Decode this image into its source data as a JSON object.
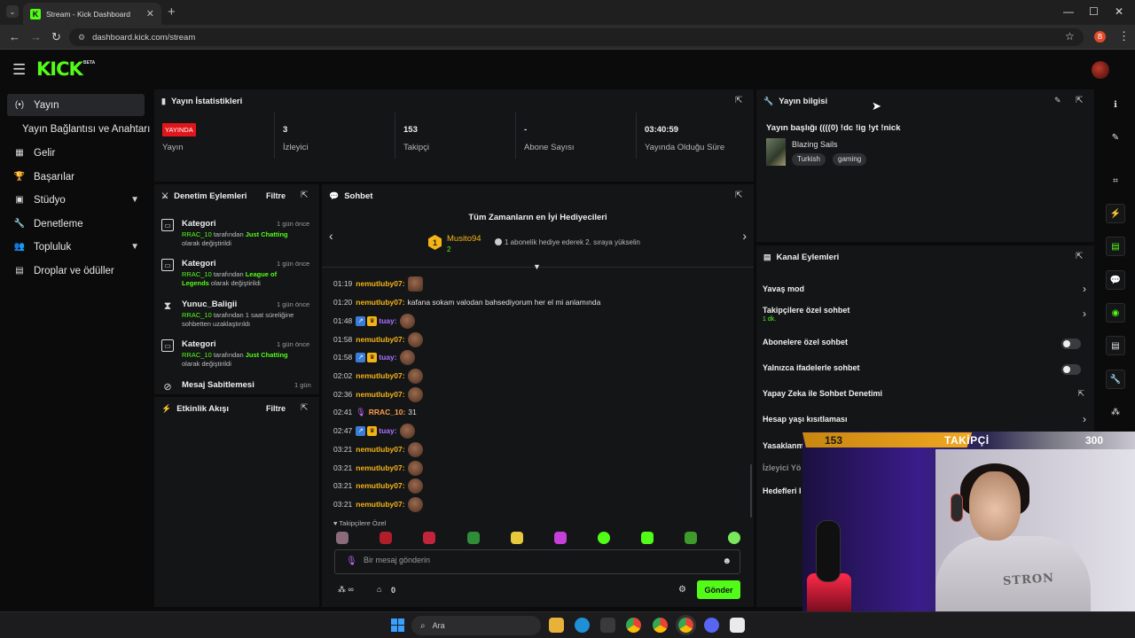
{
  "browser": {
    "tab_title": "Stream - Kick Dashboard",
    "url": "dashboard.kick.com/stream",
    "profile_initial": "B"
  },
  "header": {
    "logo": "KICK",
    "logo_badge": "BETA"
  },
  "sidebar": {
    "items": [
      {
        "label": "Yayın",
        "icon": "broadcast-icon"
      },
      {
        "label": "Yayın Bağlantısı ve Anahtarı",
        "icon": ""
      },
      {
        "label": "Gelir",
        "icon": "revenue-icon"
      },
      {
        "label": "Başarılar",
        "icon": "trophy-icon"
      },
      {
        "label": "Stüdyo",
        "icon": "studio-icon"
      },
      {
        "label": "Denetleme",
        "icon": "wrench-icon"
      },
      {
        "label": "Topluluk",
        "icon": "community-icon"
      },
      {
        "label": "Droplar ve ödüller",
        "icon": "gift-icon"
      }
    ]
  },
  "stats": {
    "title": "Yayın İstatistikleri",
    "live_badge": "YAYINDA",
    "live_label": "Yayın",
    "viewers": "3",
    "viewers_label": "İzleyici",
    "followers": "153",
    "followers_label": "Takipçi",
    "subs": "-",
    "subs_label": "Abone Sayısı",
    "uptime": "03:40:59",
    "uptime_label": "Yayında Olduğu Süre"
  },
  "moderation": {
    "title": "Denetim Eylemleri",
    "filter": "Filtre",
    "items": [
      {
        "title": "Kategori",
        "time": "1 gün önce",
        "user": "RRAC_10",
        "mid": " tarafından ",
        "target": "Just Chatting",
        "end": " olarak değiştirildi"
      },
      {
        "title": "Kategori",
        "time": "1 gün önce",
        "user": "RRAC_10",
        "mid": " tarafından ",
        "target": "League of Legends",
        "end": " olarak değiştirildi"
      },
      {
        "title": "Yunuc_Baligii",
        "time": "1 gün önce",
        "user": "RRAC_10",
        "mid": " tarafından 1 saat süreliğine sohbetten uzaklaştırıldı",
        "target": "",
        "end": ""
      },
      {
        "title": "Kategori",
        "time": "1 gün önce",
        "user": "RRAC_10",
        "mid": " tarafından ",
        "target": "Just Chatting",
        "end": " olarak değiştirildi"
      },
      {
        "title": "Mesaj Sabitlemesi",
        "time": "1 gün"
      }
    ]
  },
  "activity": {
    "title": "Etkinlik Akışı",
    "filter": "Filtre"
  },
  "chat": {
    "title": "Sohbet",
    "gifters_title": "Tüm Zamanların en İyi Hediyecileri",
    "top_gifter": {
      "rank": "1",
      "name": "Musito94",
      "count": "2"
    },
    "gifter_msg": "1 abonelik hediye ederek 2. sıraya yükselin",
    "messages": [
      {
        "time": "01:19",
        "user": "nemutluby07:",
        "text": "",
        "kind": "gold"
      },
      {
        "time": "01:20",
        "user": "nemutluby07:",
        "text": "kafana sokam valodan bahsediyorum her el mi anlamında",
        "kind": "gold"
      },
      {
        "time": "01:48",
        "user": "tuay:",
        "text": "",
        "kind": "purple"
      },
      {
        "time": "01:58",
        "user": "nemutluby07:",
        "text": "",
        "kind": "gold"
      },
      {
        "time": "01:58",
        "user": "tuay:",
        "text": "",
        "kind": "purple"
      },
      {
        "time": "02:02",
        "user": "nemutluby07:",
        "text": "",
        "kind": "gold"
      },
      {
        "time": "02:36",
        "user": "nemutluby07:",
        "text": "",
        "kind": "gold"
      },
      {
        "time": "02:41",
        "user": "RRAC_10:",
        "text": "31",
        "kind": "orange"
      },
      {
        "time": "02:47",
        "user": "tuay:",
        "text": "",
        "kind": "purple"
      },
      {
        "time": "03:21",
        "user": "nemutluby07:",
        "text": "",
        "kind": "gold"
      },
      {
        "time": "03:21",
        "user": "nemutluby07:",
        "text": "",
        "kind": "gold"
      },
      {
        "time": "03:21",
        "user": "nemutluby07:",
        "text": "",
        "kind": "gold"
      },
      {
        "time": "03:21",
        "user": "nemutluby07:",
        "text": "",
        "kind": "gold"
      }
    ],
    "followers_only": "Takipçilere Özel",
    "input_placeholder": "Bir mesaj gönderin",
    "points": "0",
    "send": "Gönder"
  },
  "stream_info": {
    "title": "Yayın bilgisi",
    "stream_title": "Yayın başlığı ((((0) !dc !ig !yt !nick",
    "category": "Blazing Sails",
    "tags": [
      "Turkish",
      "gaming"
    ]
  },
  "channel_actions": {
    "title": "Kanal Eylemleri",
    "items": [
      {
        "label": "Yavaş mod",
        "sub": "",
        "control": "chevron"
      },
      {
        "label": "Takipçilere özel sohbet",
        "sub": "1 dk.",
        "control": "chevron"
      },
      {
        "label": "Abonelere özel sohbet",
        "sub": "",
        "control": "toggle"
      },
      {
        "label": "Yalnızca ifadelerle sohbet",
        "sub": "",
        "control": "toggle"
      },
      {
        "label": "Yapay Zeka ile Sohbet Denetimi",
        "sub": "",
        "control": "external"
      },
      {
        "label": "Hesap yaşı kısıtlaması",
        "sub": "",
        "control": "chevron"
      },
      {
        "label": "Yasaklanm",
        "sub": "",
        "control": "chevron"
      },
      {
        "label": "İzleyici Yö",
        "sub": "",
        "control": ""
      },
      {
        "label": "Hedefleri I",
        "sub": "",
        "control": ""
      }
    ]
  },
  "goal": {
    "current": "153",
    "label": "TAKİPÇİ",
    "target": "300",
    "progress": 0.51
  },
  "cam": {
    "shirt_text": "STRON"
  },
  "taskbar": {
    "search_placeholder": "Ara"
  },
  "colors": {
    "accent": "#53fc18",
    "live": "#e0161b",
    "gold": "#f5b415",
    "panel": "#141517"
  }
}
